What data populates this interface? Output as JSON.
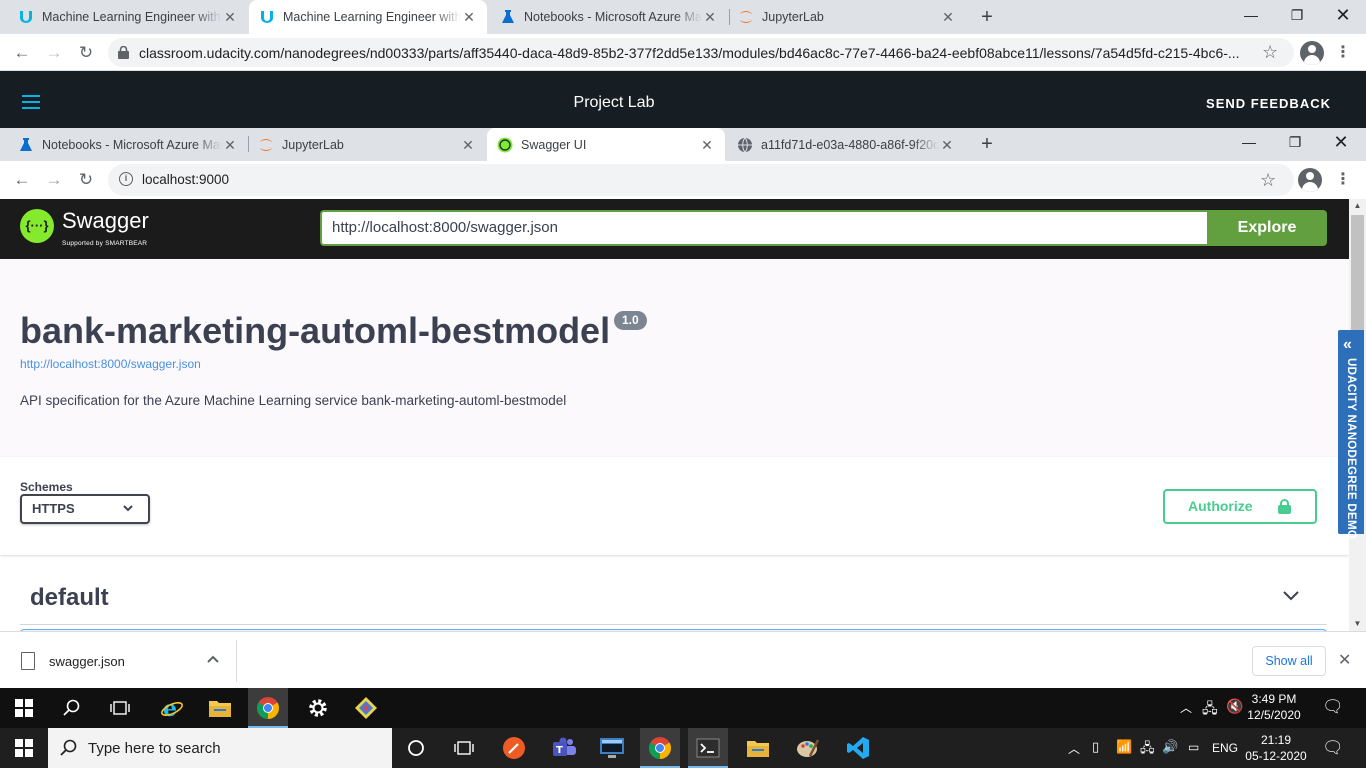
{
  "outer_browser": {
    "tabs": [
      {
        "title": "Machine Learning Engineer with Microsoft Azure",
        "icon": "udacity-icon"
      },
      {
        "title": "Machine Learning Engineer with Microsoft Azure",
        "icon": "udacity-icon"
      },
      {
        "title": "Notebooks - Microsoft Azure Machine Learning",
        "icon": "azure-ml-icon"
      },
      {
        "title": "JupyterLab",
        "icon": "jupyter-icon"
      }
    ],
    "url": "classroom.udacity.com/nanodegrees/nd00333/parts/aff35440-daca-48d9-85b2-377f2dd5e133/modules/bd46ac8c-77e7-4466-ba24-eebf08abce11/lessons/7a54d5fd-c215-4bc6-..."
  },
  "udacity": {
    "title": "Project Lab",
    "feedback": "SEND FEEDBACK",
    "demo_tab": "UDACITY NANODEGREE DEMO"
  },
  "inner_browser": {
    "tabs": [
      {
        "title": "Notebooks - Microsoft Azure Machine Learning",
        "icon": "azure-ml-icon"
      },
      {
        "title": "JupyterLab",
        "icon": "jupyter-icon"
      },
      {
        "title": "Swagger UI",
        "icon": "swagger-icon"
      },
      {
        "title": "a11fd71d-e03a-4880-a86f-9f20df",
        "icon": "globe-icon"
      }
    ],
    "url": "localhost:9000"
  },
  "swagger": {
    "brand": "Swagger",
    "brand_sub": "Supported by SMARTBEAR",
    "spec_url": "http://localhost:8000/swagger.json",
    "explore": "Explore",
    "title": "bank-marketing-automl-bestmodel",
    "version": "1.0",
    "link": "http://localhost:8000/swagger.json",
    "description": "API specification for the Azure Machine Learning service bank-marketing-automl-bestmodel",
    "schemes_label": "Schemes",
    "scheme": "HTTPS",
    "authorize": "Authorize",
    "section": "default"
  },
  "download": {
    "filename": "swagger.json",
    "show_all": "Show all"
  },
  "taskbar_inner": {
    "time": "3:49 PM",
    "date": "12/5/2020"
  },
  "taskbar_outer": {
    "search_placeholder": "Type here to search",
    "lang": "ENG",
    "time": "21:19",
    "date": "05-12-2020"
  },
  "colors": {
    "swagger_green": "#62a03f",
    "authorize_green": "#49cc90",
    "udacity_dark": "#171e23",
    "udacity_blue": "#02b3e4",
    "demo_blue": "#2d6fb8"
  }
}
